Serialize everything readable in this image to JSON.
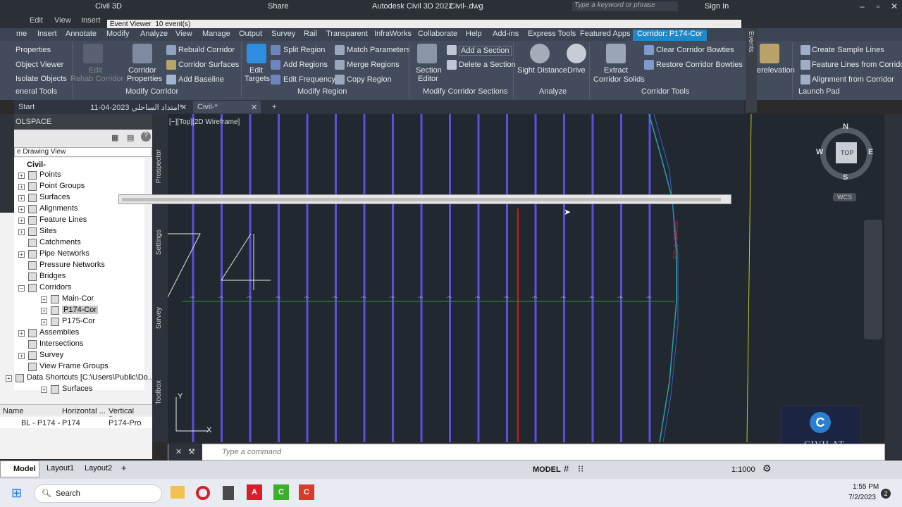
{
  "title": {
    "app": "Autodesk Civil 3D 2022",
    "file": "Civil-.dwg",
    "workspace": "Civil 3D",
    "share": "Share",
    "search_placeholder": "Type a keyword or phrase",
    "sign_in": "Sign In"
  },
  "menu": [
    "Edit",
    "View",
    "Insert"
  ],
  "event_viewer": {
    "label": "Event Viewer",
    "count": "10 event(s)"
  },
  "ribbon_tabs": [
    "me",
    "Insert",
    "Annotate",
    "Modify",
    "Analyze",
    "View",
    "Manage",
    "Output",
    "Survey",
    "Rail",
    "Transparent",
    "InfraWorks",
    "Collaborate",
    "Help",
    "Add-ins",
    "Express Tools",
    "Featured Apps",
    "Corridor: P174-Cor"
  ],
  "ribbon": {
    "props": [
      "Properties",
      "Object Viewer",
      "Isolate Objects",
      "eneral Tools"
    ],
    "edit_rehab": [
      "Edit",
      "Rehab Corridor"
    ],
    "corr_props": [
      "Corridor",
      "Properties"
    ],
    "modify_corridor": [
      "Rebuild Corridor",
      "Corridor Surfaces",
      "Add Baseline"
    ],
    "modify_corridor_panel": "Modify Corridor",
    "edit_targets": [
      "Edit",
      "Targets"
    ],
    "region": [
      "Split Region",
      "Add Regions",
      "Edit Frequency",
      "Match Parameters",
      "Merge Regions",
      "Copy Region"
    ],
    "modify_region_panel": "Modify Region",
    "section_editor": [
      "Section",
      "Editor"
    ],
    "sections": [
      "Add a Section",
      "Delete a Section"
    ],
    "modify_sections_panel": "Modify Corridor Sections",
    "analyze": [
      "Sight Distance",
      "Drive"
    ],
    "analyze_panel": "Analyze",
    "extract": [
      "Extract",
      "Corridor Solids"
    ],
    "bowties": [
      "Clear Corridor Bowties",
      "Restore Corridor Bowties"
    ],
    "tools_panel": "Corridor Tools",
    "relev": "erelevation",
    "launch": [
      "Create Sample Lines",
      "Feature Lines from Corridor",
      "Alignment from Corridor"
    ],
    "launch_panel": "Launch Pad"
  },
  "doc_tabs": [
    "Start",
    "امتداد الساحلي 2023-04-11*",
    "Civil-*"
  ],
  "toolspace": {
    "title": "OLSPACE",
    "view": "e Drawing View",
    "items": [
      "Civil-",
      "Points",
      "Point Groups",
      "Surfaces",
      "Alignments",
      "Feature Lines",
      "Sites",
      "Catchments",
      "Pipe Networks",
      "Pressure Networks",
      "Bridges",
      "Corridors",
      "Main-Cor",
      "P174-Cor",
      "P175-Cor",
      "Assemblies",
      "Intersections",
      "Survey",
      "View Frame Groups",
      "Data Shortcuts [C:\\Users\\Public\\Do...",
      "Surfaces"
    ],
    "vtabs": [
      "Prospector",
      "Settings",
      "Survey",
      "Toolbox"
    ],
    "table": {
      "headers": [
        "Name",
        "Horizontal ...",
        "Vertical Bas..."
      ],
      "row": [
        "BL - P174 -",
        "P174",
        "P174-Pro"
      ]
    }
  },
  "viewport": {
    "label": "[−][Top][2D Wireframe]",
    "station": "EP: 1+040.00",
    "compass": {
      "n": "N",
      "s": "S",
      "e": "E",
      "w": "W",
      "top": "TOP",
      "wcs": "WCS"
    }
  },
  "command": {
    "placeholder": "Type a command"
  },
  "layout_tabs": [
    "Model",
    "Layout1",
    "Layout2"
  ],
  "status": {
    "model": "MODEL",
    "scale": "1:1000"
  },
  "taskbar": {
    "search": "Search",
    "time": "1:55 PM",
    "date": "7/2/2023",
    "badge": "2"
  },
  "logo": {
    "text": "CIVILAT",
    "letter": "C"
  },
  "colors": {
    "corridor_line": "#5c4fe0",
    "red_line": "#d01a1a",
    "green_line": "#3a8f3a",
    "active_tab": "#1e88c8"
  }
}
